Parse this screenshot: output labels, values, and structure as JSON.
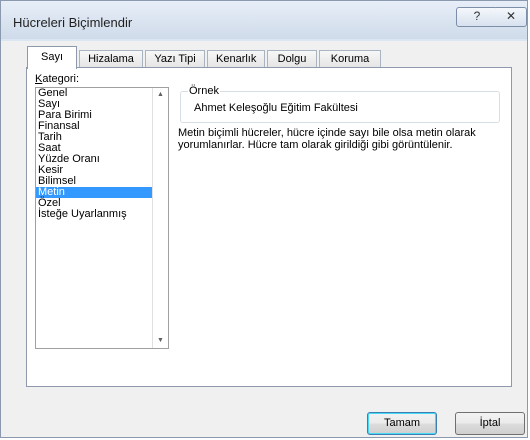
{
  "window": {
    "title": "Hücreleri Biçimlendir",
    "help": "?",
    "close": "✕"
  },
  "tabs": [
    {
      "label": "Sayı"
    },
    {
      "label": "Hizalama"
    },
    {
      "label": "Yazı Tipi"
    },
    {
      "label": "Kenarlık"
    },
    {
      "label": "Dolgu"
    },
    {
      "label": "Koruma"
    }
  ],
  "category": {
    "label_prefix": "K",
    "label_rest": "ategori:",
    "items": [
      "Genel",
      "Sayı",
      "Para Birimi",
      "Finansal",
      "Tarih",
      "Saat",
      "Yüzde Oranı",
      "Kesir",
      "Bilimsel",
      "Metin",
      "Özel",
      "İsteğe Uyarlanmış"
    ],
    "selected": "Metin"
  },
  "sample": {
    "legend": "Örnek",
    "value": "Ahmet Keleşoğlu Eğitim Fakültesi"
  },
  "description": "Metin biçimli hücreler, hücre içinde sayı bile olsa metin olarak yorumlanırlar. Hücre tam olarak girildiği gibi görüntülenir.",
  "buttons": {
    "ok": "Tamam",
    "cancel": "İptal"
  },
  "icons": {
    "scroll_up": "▲",
    "scroll_down": "▼"
  }
}
